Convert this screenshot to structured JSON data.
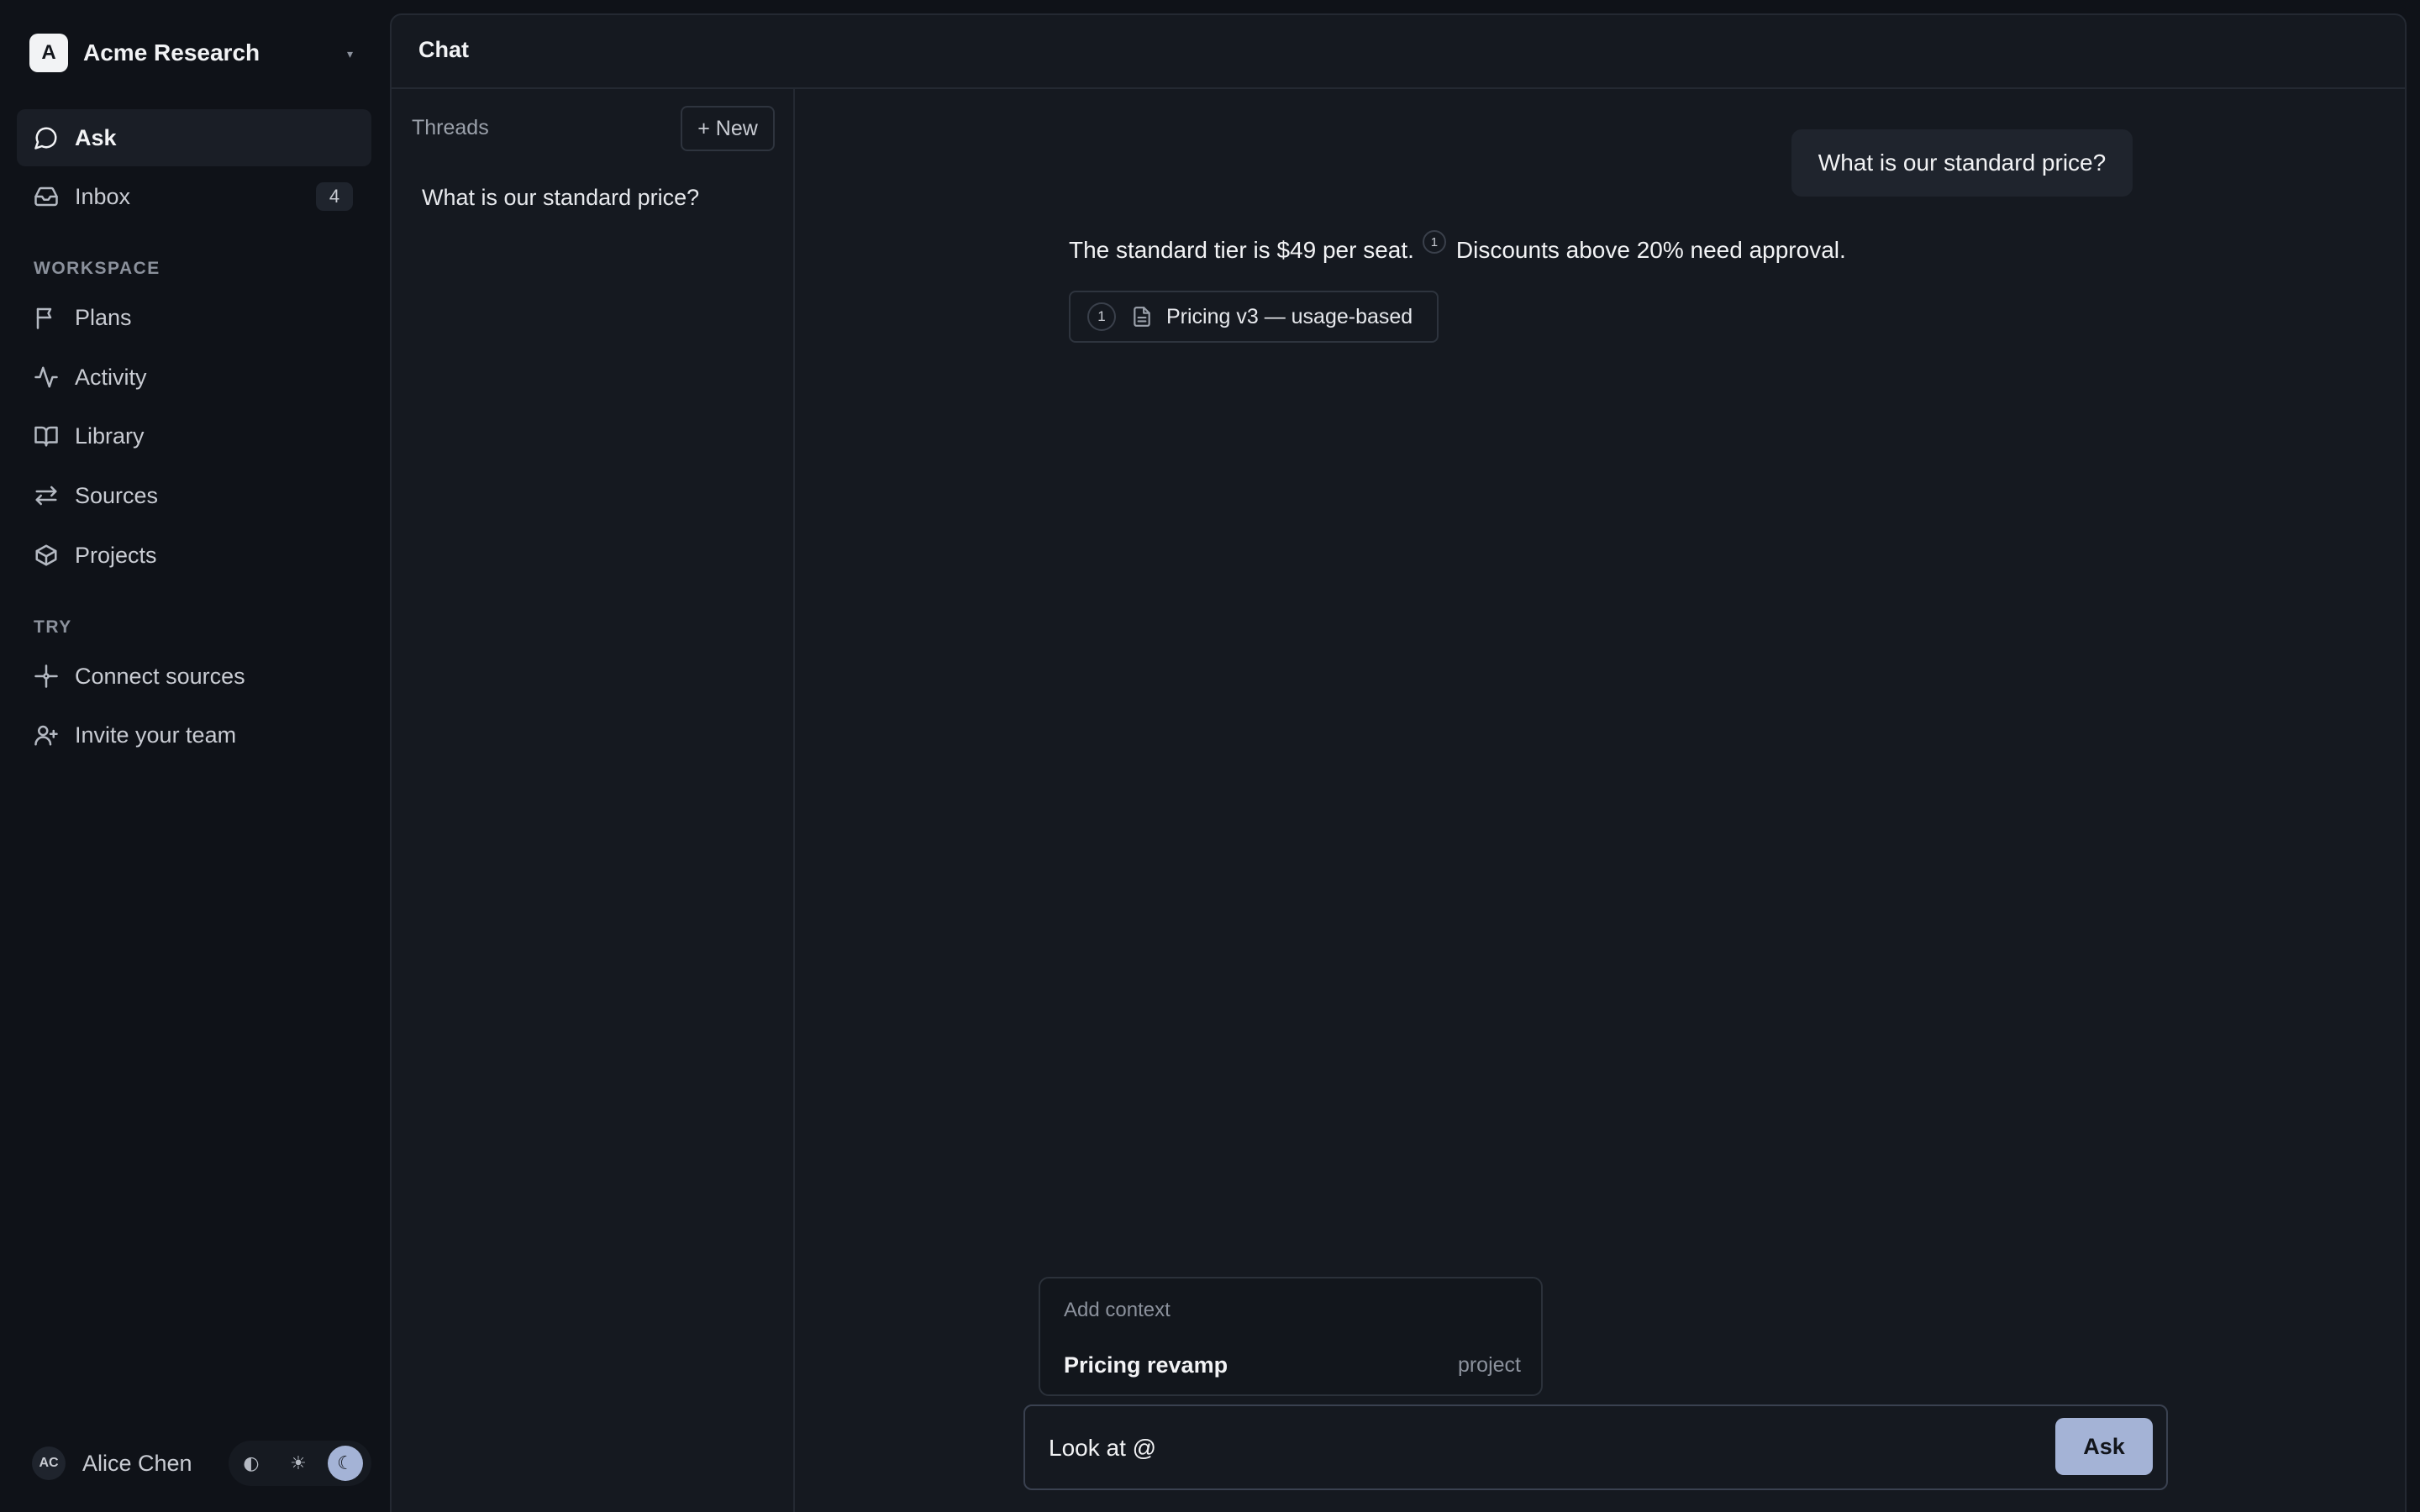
{
  "workspace": {
    "initial": "A",
    "name": "Acme Research",
    "caret": "▾"
  },
  "nav": {
    "ask": "Ask",
    "inbox": "Inbox",
    "inbox_badge": "4",
    "workspace_heading": "WORKSPACE",
    "plans": "Plans",
    "activity": "Activity",
    "library": "Library",
    "sources": "Sources",
    "projects": "Projects",
    "try_heading": "TRY",
    "connect_sources": "Connect sources",
    "invite_team": "Invite your team"
  },
  "user": {
    "initials": "AC",
    "name": "Alice Chen"
  },
  "theme": {
    "auto": "◐",
    "light": "☀",
    "dark": "☾",
    "selected": "dark"
  },
  "main": {
    "title": "Chat"
  },
  "threads": {
    "label": "Threads",
    "new_label": "+ New",
    "items": [
      "What is our standard price?"
    ]
  },
  "conversation": {
    "user_message": "What is our standard price?",
    "answer_part1": "The standard tier is $49 per seat.",
    "citation_marker": "1",
    "answer_part2": "Discounts above 20% need approval.",
    "source": {
      "number": "1",
      "title": "Pricing v3 — usage-based"
    }
  },
  "context_menu": {
    "heading": "Add context",
    "items": [
      {
        "title": "Pricing revamp",
        "kind": "project"
      }
    ]
  },
  "composer": {
    "value": "Look at @",
    "ask_label": "Ask"
  },
  "colors": {
    "background": "#0f1218",
    "panel": "#151920",
    "accent": "#a4b3d6",
    "border": "#242932"
  }
}
